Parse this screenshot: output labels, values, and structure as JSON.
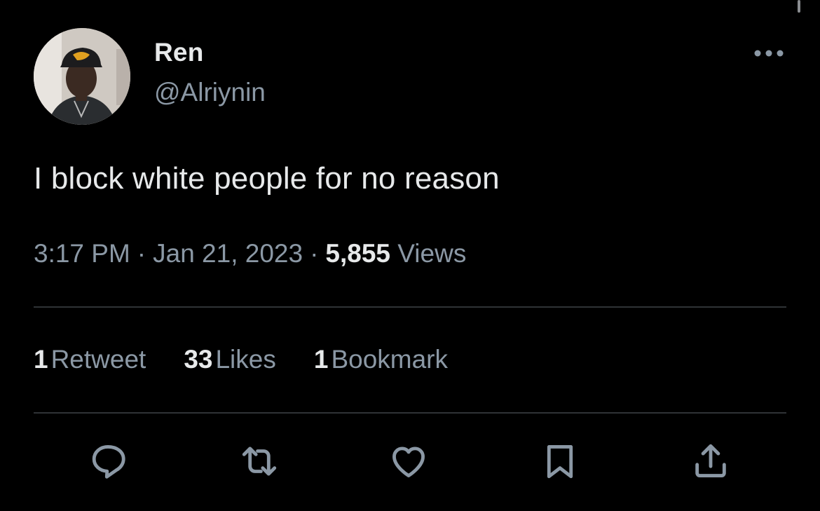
{
  "tweet": {
    "author": {
      "display_name": "Ren",
      "handle": "@Alriynin",
      "avatar": "profile-photo"
    },
    "text": "I block white people for no reason",
    "time": "3:17 PM",
    "separator": "·",
    "date": "Jan 21, 2023",
    "views_count": "5,855",
    "views_label": "Views"
  },
  "stats": {
    "retweets": {
      "count": "1",
      "label": "Retweet"
    },
    "likes": {
      "count": "33",
      "label": "Likes"
    },
    "bookmarks": {
      "count": "1",
      "label": "Bookmark"
    }
  },
  "actions": [
    {
      "icon": "reply-icon"
    },
    {
      "icon": "retweet-icon"
    },
    {
      "icon": "like-icon"
    },
    {
      "icon": "bookmark-icon"
    },
    {
      "icon": "share-icon"
    }
  ],
  "colors": {
    "background": "#000000",
    "primary_text": "#e7e9ea",
    "secondary_text": "#8b98a5",
    "divider": "#2f3336",
    "icon": "#8b98a5"
  }
}
